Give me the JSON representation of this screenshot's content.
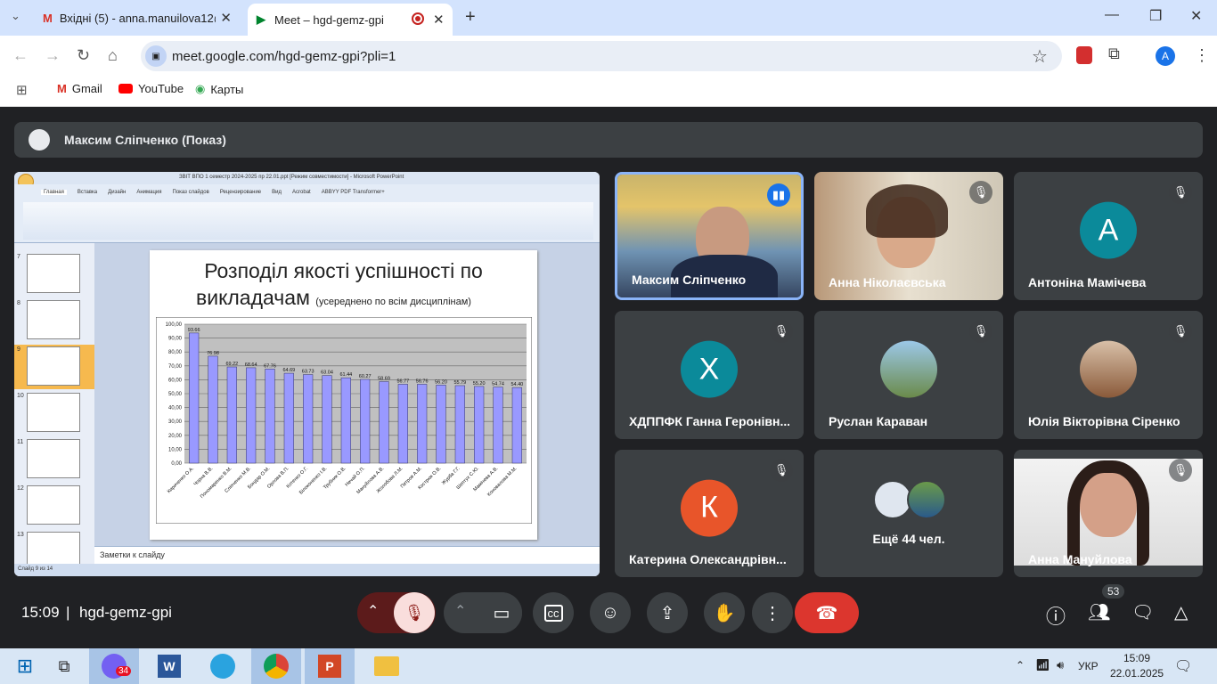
{
  "browser": {
    "tabs": [
      {
        "label": "Вхідні (5) - anna.manuilova12@"
      },
      {
        "label": "Meet – hgd-gemz-gpi"
      }
    ],
    "url": "meet.google.com/hgd-gemz-gpi?pli=1",
    "bookmarks": [
      {
        "label": "Gmail"
      },
      {
        "label": "YouTube"
      },
      {
        "label": "Карты"
      }
    ],
    "profile": "A"
  },
  "meet": {
    "presenter": "Максим Сліпченко (Показ)",
    "participants": [
      {
        "name": "Максим Сліпченко"
      },
      {
        "name": "Анна Ніколаєвська"
      },
      {
        "name": "Антоніна Мамічева",
        "initial": "А",
        "color": "#0b8a9a"
      },
      {
        "name": "ХДППФК Ганна Геронівн...",
        "initial": "Х",
        "color": "#0b8a9a"
      },
      {
        "name": "Руслан Караван"
      },
      {
        "name": "Юлія Вікторівна Сіренко"
      },
      {
        "name": "Катерина Олександрівн...",
        "initial": "К",
        "color": "#e8552a"
      },
      {
        "name": "Ещё 44 чел."
      },
      {
        "name": "Анна Мануйлова"
      }
    ],
    "time": "15:09",
    "code": "hgd-gemz-gpi",
    "people_count": "53"
  },
  "ppt": {
    "title": "ЗВІТ ВПО 1 семестр 2024-2025 пр 22.01.ppt [Режим совместимости] - Microsoft PowerPoint",
    "ribbon_tabs": [
      "Главная",
      "Вставка",
      "Дизайн",
      "Анимация",
      "Показ слайдов",
      "Рецензирование",
      "Вид",
      "Acrobat",
      "ABBYY PDF Transformer+"
    ],
    "notes": "Заметки к слайду",
    "status": "Слайд 9 из 14",
    "slide_title_1": "Розподіл якості успішності по",
    "slide_title_2": "викладачам",
    "slide_subtitle": "(усереднено по всім дисциплінам)",
    "slide_nums": [
      "7",
      "8",
      "9",
      "10",
      "11",
      "12",
      "13"
    ]
  },
  "chart_data": {
    "type": "bar",
    "categories": [
      "Кириченко О.А.",
      "Чорна В.В.",
      "Пономаренко В.М.",
      "Сліпченко М.В.",
      "Бондар О.М.",
      "Орлова В.П.",
      "Котенко О.Г.",
      "Білоконенко І.В.",
      "Трубник О.В.",
      "Нечай О.П.",
      "Мануйлова А.В.",
      "Жолобова Л.М.",
      "Петров А.М.",
      "Кострюк О.В.",
      "Журба Г.Г.",
      "Шептух С.Ю.",
      "Мамічева А.В.",
      "Коновалова М.М."
    ],
    "values": [
      93.66,
      76.98,
      69.22,
      68.64,
      67.76,
      64.69,
      63.73,
      63.04,
      61.44,
      60.27,
      58.69,
      56.77,
      56.76,
      56.2,
      55.79,
      55.2,
      54.74,
      54.4
    ],
    "ylim": [
      0,
      100
    ],
    "yticks": [
      "0,00",
      "10,00",
      "20,00",
      "30,00",
      "40,00",
      "50,00",
      "60,00",
      "70,00",
      "80,00",
      "90,00",
      "100,00"
    ]
  },
  "taskbar": {
    "time": "15:09",
    "date": "22.01.2025",
    "lang": "УКР",
    "viber_badge": "34"
  }
}
